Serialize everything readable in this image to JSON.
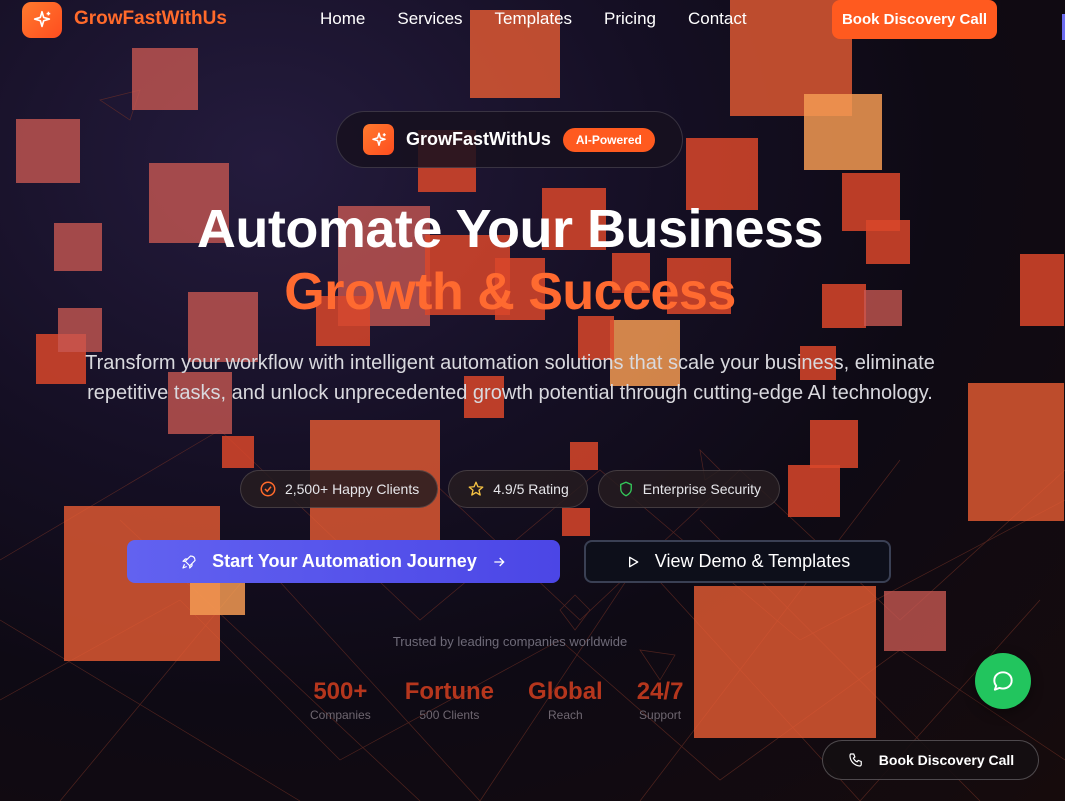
{
  "nav": {
    "brand": "GrowFastWithUs",
    "links": [
      "Home",
      "Services",
      "Templates",
      "Pricing",
      "Contact"
    ],
    "cta": "Book Discovery Call"
  },
  "hero": {
    "pill_name": "GrowFastWithUs",
    "pill_badge": "AI-Powered",
    "headline_1": "Automate Your Business",
    "headline_2": "Growth & Success",
    "subtitle": "Transform your workflow with intelligent automation solutions that scale your business, eliminate repetitive tasks, and unlock unprecedented growth potential through cutting-edge AI technology.",
    "chips": [
      {
        "icon": "check-circle-icon",
        "label": "2,500+ Happy Clients"
      },
      {
        "icon": "star-icon",
        "label": "4.9/5 Rating"
      },
      {
        "icon": "shield-icon",
        "label": "Enterprise Security"
      }
    ],
    "primary_button": "Start Your Automation Journey",
    "secondary_button": "View Demo & Templates"
  },
  "trust": {
    "caption": "Trusted by leading companies worldwide",
    "stats": [
      {
        "value": "500+",
        "label": "Companies"
      },
      {
        "value": "Fortune",
        "label": "500 Clients"
      },
      {
        "value": "Global",
        "label": "Reach"
      },
      {
        "value": "24/7",
        "label": "Support"
      }
    ]
  },
  "floating": {
    "book_call": "Book Discovery Call",
    "chat_icon": "chat-bubble-icon"
  },
  "colors": {
    "accent": "#ff5a1f",
    "primary_button": "#5b5bee",
    "chat": "#22c55e"
  }
}
